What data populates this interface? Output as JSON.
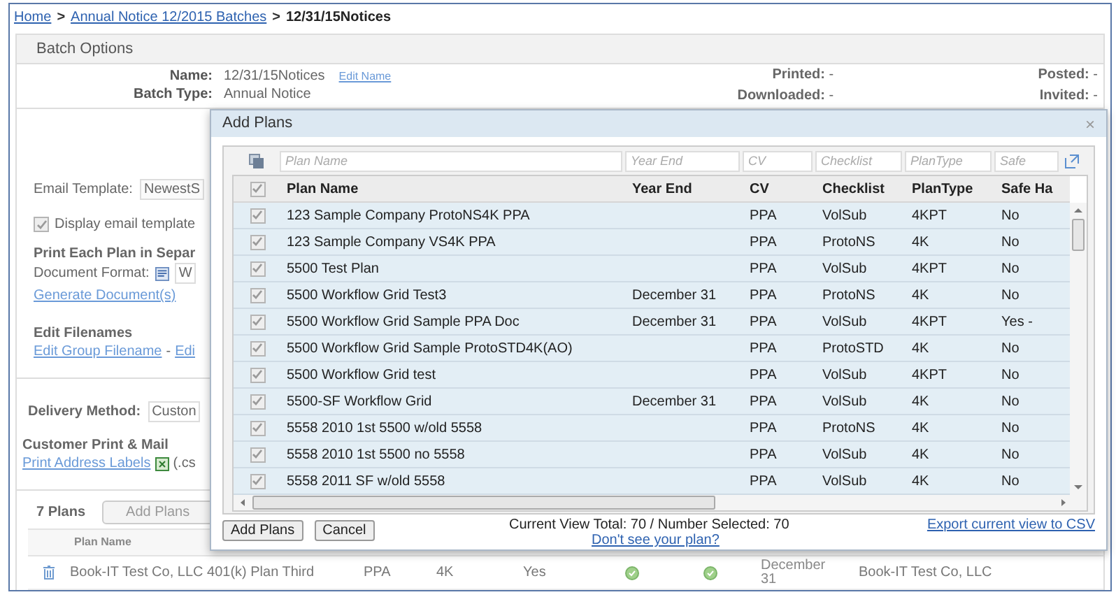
{
  "breadcrumb": [
    {
      "kind": "link",
      "label": "Home"
    },
    {
      "kind": "separator",
      "label": ">"
    },
    {
      "kind": "link",
      "label": "Annual Notice 12/2015 Batches"
    },
    {
      "kind": "separator",
      "label": ">"
    },
    {
      "kind": "current",
      "label": "12/31/15Notices"
    }
  ],
  "batch_options": {
    "title": "Batch Options",
    "name_label": "Name:",
    "name_value": "12/31/15Notices",
    "edit_name": "Edit Name",
    "batch_type_label": "Batch Type:",
    "batch_type_value": "Annual Notice",
    "status": [
      "**Printed:** -",
      "**Posted:** -",
      "**Downloaded:** -",
      "**Invited:** -"
    ],
    "email_template_label": "Email Template:",
    "email_template_value": "NewestS",
    "display_email": {
      "label": "Display email template",
      "checked": true
    },
    "print_each_heading": "Print Each Plan in Separ",
    "document_format_label": "Document Format:",
    "document_format_value": "W",
    "generate_link": "Generate Document(s)",
    "edit_filenames_heading": "Edit Filenames",
    "edit_group_link": "Edit Group Filename",
    "link_separator": "-",
    "edit_other_link": "Edi",
    "delivery_label": "Delivery Method:",
    "delivery_value": "Custon",
    "customer_print_heading": "Customer Print & Mail",
    "print_labels_link": "Print Address Labels",
    "labels_suffix": "(.cs"
  },
  "plans": {
    "count": "7 Plans",
    "add_button": "Add Plans",
    "columns": [
      "Plan Name"
    ],
    "rows": [
      {
        "plan_name": "Book-IT Test Co, LLC 401(k) Plan Third",
        "cv": "PPA",
        "plan_type": "4K",
        "safe_harbor": "Yes",
        "year_end": "December 31",
        "company": "Book-IT Test Co, LLC"
      }
    ]
  },
  "dialog": {
    "title": "Add Plans",
    "close": "×",
    "filters": [
      {
        "placeholder": "Plan Name"
      },
      {
        "placeholder": "Year End"
      },
      {
        "placeholder": "CV"
      },
      {
        "placeholder": "Checklist"
      },
      {
        "placeholder": "PlanType"
      },
      {
        "placeholder": "Safe"
      }
    ],
    "select_all_checked": true,
    "columns": [
      "Plan Name",
      "Year End",
      "CV",
      "Checklist",
      "PlanType",
      "Safe Ha"
    ],
    "rows": [
      {
        "checked": true,
        "cells": [
          "123 Sample Company ProtoNS4K PPA",
          "",
          "PPA",
          "VolSub",
          "4KPT",
          "No"
        ]
      },
      {
        "checked": true,
        "cells": [
          "123 Sample Company VS4K PPA",
          "",
          "PPA",
          "ProtoNS",
          "4K",
          "No"
        ]
      },
      {
        "checked": true,
        "cells": [
          "5500 Test Plan",
          "",
          "PPA",
          "VolSub",
          "4KPT",
          "No"
        ]
      },
      {
        "checked": true,
        "cells": [
          "5500 Workflow Grid Test3",
          "December 31",
          "PPA",
          "ProtoNS",
          "4K",
          "No"
        ]
      },
      {
        "checked": true,
        "cells": [
          "5500 Workflow Grid Sample PPA Doc",
          "December 31",
          "PPA",
          "VolSub",
          "4KPT",
          "Yes -"
        ]
      },
      {
        "checked": true,
        "cells": [
          "5500 Workflow Grid Sample ProtoSTD4K(AO)",
          "",
          "PPA",
          "ProtoSTD",
          "4K",
          "No"
        ]
      },
      {
        "checked": true,
        "cells": [
          "5500 Workflow Grid test",
          "",
          "PPA",
          "VolSub",
          "4KPT",
          "No"
        ]
      },
      {
        "checked": true,
        "cells": [
          "5500-SF Workflow Grid",
          "December 31",
          "PPA",
          "VolSub",
          "4K",
          "No"
        ]
      },
      {
        "checked": true,
        "cells": [
          "5558 2010 1st 5500 w/old 5558",
          "",
          "PPA",
          "ProtoNS",
          "4K",
          "No"
        ]
      },
      {
        "checked": true,
        "cells": [
          "5558 2010 1st 5500 no 5558",
          "",
          "PPA",
          "VolSub",
          "4K",
          "No"
        ]
      },
      {
        "checked": true,
        "cells": [
          "5558 2011 SF w/old 5558",
          "",
          "PPA",
          "VolSub",
          "4K",
          "No"
        ]
      }
    ],
    "buttons": [
      "Add Plans",
      "Cancel"
    ],
    "summary": "Current View Total: 70 / Number Selected: 70",
    "help_link": "Don't see your plan?",
    "export_link": "Export current view to CSV"
  }
}
